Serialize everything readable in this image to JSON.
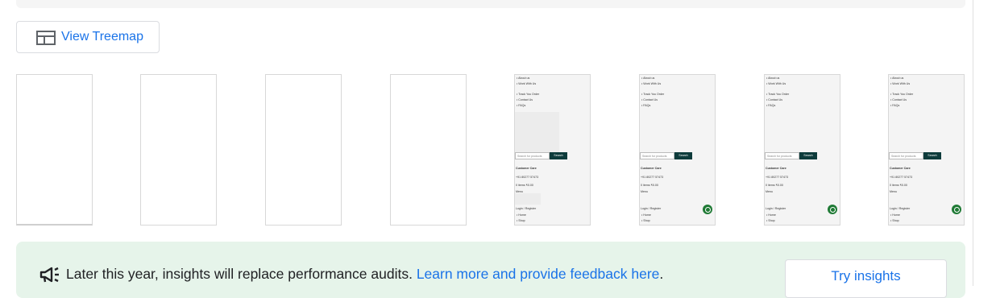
{
  "treemap_button": {
    "label": "View Treemap",
    "icon": "treemap-icon"
  },
  "filmstrip": {
    "frames": [
      {
        "filled": false
      },
      {
        "filled": false
      },
      {
        "filled": false
      },
      {
        "filled": false
      },
      {
        "filled": true,
        "fab": false
      },
      {
        "filled": true,
        "fab": true
      },
      {
        "filled": true,
        "fab": true
      },
      {
        "filled": true,
        "fab": true
      }
    ],
    "mini_page": {
      "links_top": [
        "About us",
        "Work With Us"
      ],
      "links_mid": [
        "Track You Order",
        "Contact Us",
        "FAQs"
      ],
      "search_placeholder": "Search for products",
      "search_button": "Search",
      "customer_care": "Customer Care",
      "phone": "+91 80277 57473",
      "cart": "0 items ₹0.00",
      "menu": "Menu",
      "login": "Login / Register",
      "links_bottom": [
        "Home",
        "Shop"
      ]
    }
  },
  "banner": {
    "icon": "megaphone-icon",
    "text": "Later this year, insights will replace performance audits.",
    "link": "Learn more and provide feedback here",
    "suffix": ".",
    "button": "Try insights",
    "colors": {
      "background": "#e6f4ea",
      "link": "#1a73e8"
    }
  }
}
